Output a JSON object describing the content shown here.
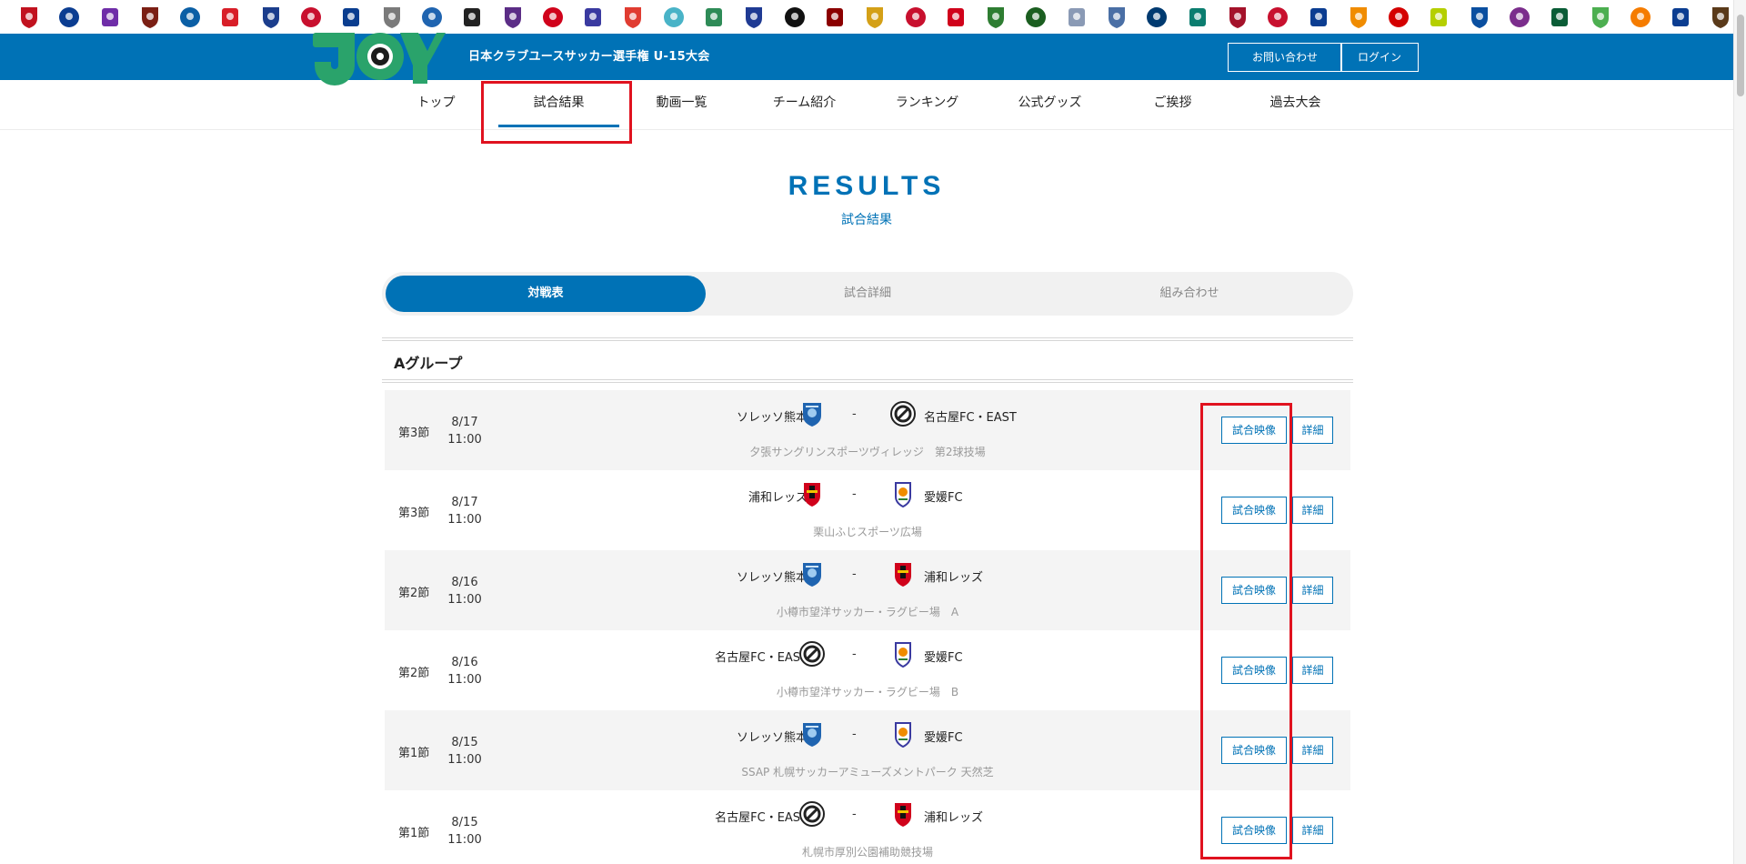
{
  "emblem_colors": [
    "#c1121f",
    "#0b3d91",
    "#6f2da8",
    "#7b1f14",
    "#0b5fa5",
    "#d81e28",
    "#1b3d8c",
    "#c8102e",
    "#0a3d8f",
    "#7a7a7a",
    "#1f64b0",
    "#222222",
    "#5b2d86",
    "#d0021b",
    "#3a3aa0",
    "#e03c31",
    "#49b3c7",
    "#2e8b57",
    "#1f3a93",
    "#111111",
    "#8b0000",
    "#d4a017",
    "#c8102e",
    "#d0021b",
    "#2e7d32",
    "#1b5e20",
    "#8a9ab5",
    "#4a6fa5",
    "#003a70",
    "#0b7d6f",
    "#a4122a",
    "#c8102e",
    "#0b3d91",
    "#f08c00",
    "#d40000",
    "#b5cf00",
    "#0a4fa0",
    "#7b2d8c",
    "#0a5c36",
    "#4caf50",
    "#f57c00",
    "#0b3d91",
    "#5a3a1a"
  ],
  "header": {
    "site_title": "日本クラブユースサッカー選手権 U-15大会",
    "contact_label": "お問い合わせ",
    "login_label": "ログイン"
  },
  "nav": [
    "トップ",
    "試合結果",
    "動画一覧",
    "チーム紹介",
    "ランキング",
    "公式グッズ",
    "ご挨拶",
    "過去大会"
  ],
  "page": {
    "title": "RESULTS",
    "subtitle": "試合結果"
  },
  "tabs": [
    "対戦表",
    "試合詳細",
    "組み合わせ"
  ],
  "group": {
    "title": "Aグループ"
  },
  "buttons": {
    "video": "試合映像",
    "detail": "詳細"
  },
  "matches": [
    {
      "round": "第3節",
      "date": "8/17",
      "time": "11:00",
      "home": "ソレッソ熊本",
      "away": "名古屋FC・EAST",
      "score": "-",
      "venue": "夕張サングリンスポーツヴィレッジ　第2球技場"
    },
    {
      "round": "第3節",
      "date": "8/17",
      "time": "11:00",
      "home": "浦和レッズ",
      "away": "愛媛FC",
      "score": "-",
      "venue": "栗山ふじスポーツ広場"
    },
    {
      "round": "第2節",
      "date": "8/16",
      "time": "11:00",
      "home": "ソレッソ熊本",
      "away": "浦和レッズ",
      "score": "-",
      "venue": "小樽市望洋サッカー・ラグビー場　A"
    },
    {
      "round": "第2節",
      "date": "8/16",
      "time": "11:00",
      "home": "名古屋FC・EAST",
      "away": "愛媛FC",
      "score": "-",
      "venue": "小樽市望洋サッカー・ラグビー場　B"
    },
    {
      "round": "第1節",
      "date": "8/15",
      "time": "11:00",
      "home": "ソレッソ熊本",
      "away": "愛媛FC",
      "score": "-",
      "venue": "SSAP 札幌サッカーアミューズメントパーク 天然芝"
    },
    {
      "round": "第1節",
      "date": "8/15",
      "time": "11:00",
      "home": "名古屋FC・EAST",
      "away": "浦和レッズ",
      "score": "-",
      "venue": "札幌市厚別公園補助競技場"
    }
  ]
}
